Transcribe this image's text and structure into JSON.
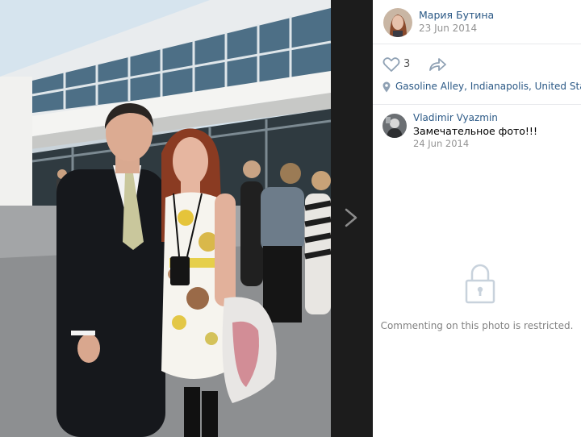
{
  "post": {
    "author": "Мария Бутина",
    "date": "23 Jun 2014",
    "likes": "3",
    "location": "Gasoline Alley, Indianapolis, United Stat..."
  },
  "comments": [
    {
      "author": "Vladimir Vyazmin",
      "text": "Замечательное фото!!!",
      "date": "24 Jun 2014"
    }
  ],
  "restriction_notice": "Commenting on this photo is restricted.",
  "icons": {
    "like": "heart-icon",
    "share": "share-arrow-icon",
    "location": "map-pin-icon",
    "lock": "lock-icon",
    "next": "chevron-right-icon"
  },
  "colors": {
    "link": "#2a5885",
    "muted": "#939393",
    "dark_strip": "#1c1c1c"
  }
}
